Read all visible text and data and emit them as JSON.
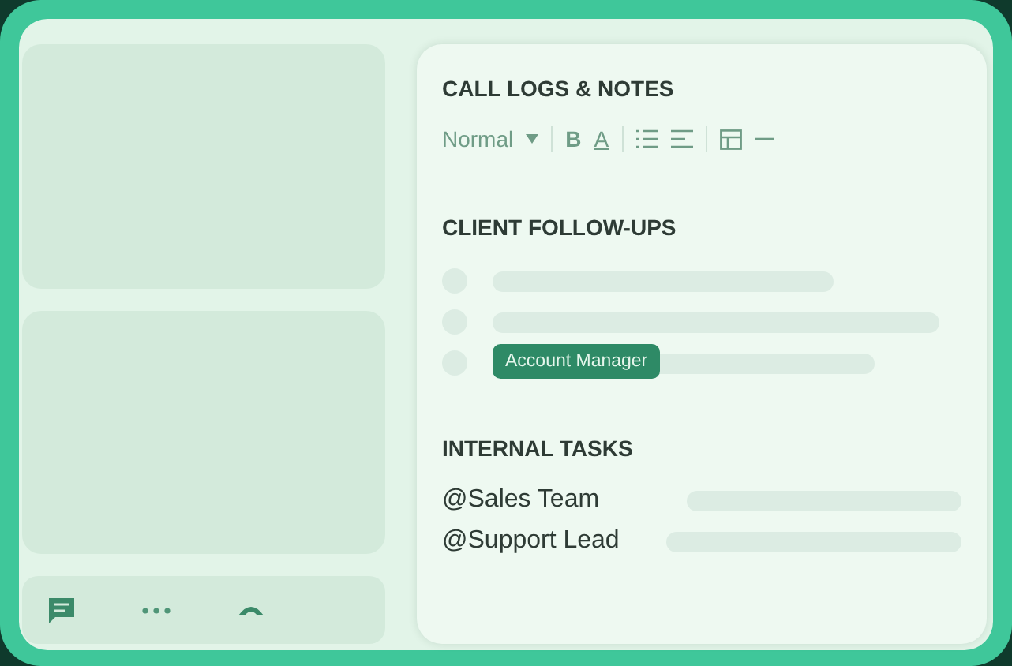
{
  "editor": {
    "title": "CALL LOGS & NOTES",
    "toolbar": {
      "style": "Normal",
      "bold": "B",
      "text_style": "A"
    }
  },
  "follow_ups": {
    "title": "CLIENT FOLLOW-UPS",
    "items": [
      {
        "kind": "line"
      },
      {
        "kind": "line"
      },
      {
        "kind": "tagged",
        "tag": "Account Manager"
      }
    ]
  },
  "tasks": {
    "title": "INTERNAL TASKS",
    "rows": [
      {
        "mention": "@Sales Team"
      },
      {
        "mention": "@Support Lead"
      }
    ]
  }
}
